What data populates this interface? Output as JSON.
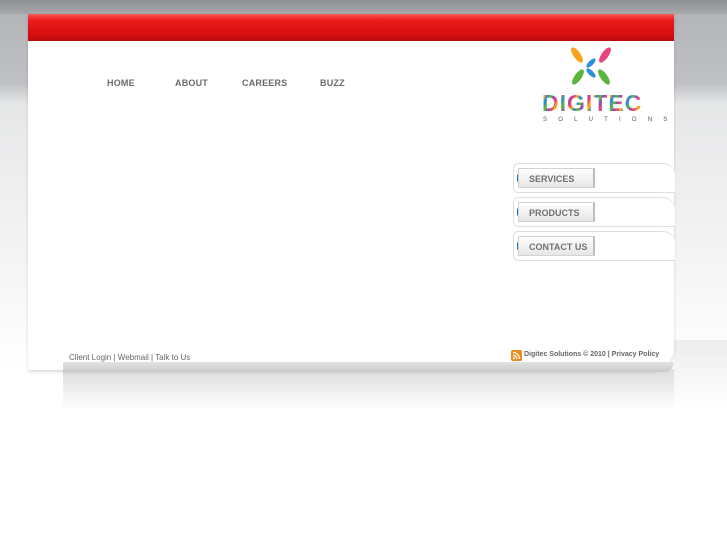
{
  "nav": [
    {
      "label": "HOME"
    },
    {
      "label": "ABOUT"
    },
    {
      "label": "CAREERS"
    },
    {
      "label": "BUZZ"
    }
  ],
  "logo": {
    "word": "DIGITEC",
    "sub": "SOLUTIONS"
  },
  "side_menu": [
    {
      "label": "SERVICES"
    },
    {
      "label": "PRODUCTS"
    },
    {
      "label": "CONTACT US"
    }
  ],
  "footer": {
    "client_login": "Client Login",
    "sep1": " | ",
    "webmail": "Webmail",
    "sep2": " | ",
    "talk": "Talk to Us",
    "copyright": "Digitec Solutions © 2010",
    "sep3": " | ",
    "privacy": "Privacy Policy"
  },
  "icons": {
    "rss": "rss-icon",
    "arrow": "triangle-right-icon"
  }
}
